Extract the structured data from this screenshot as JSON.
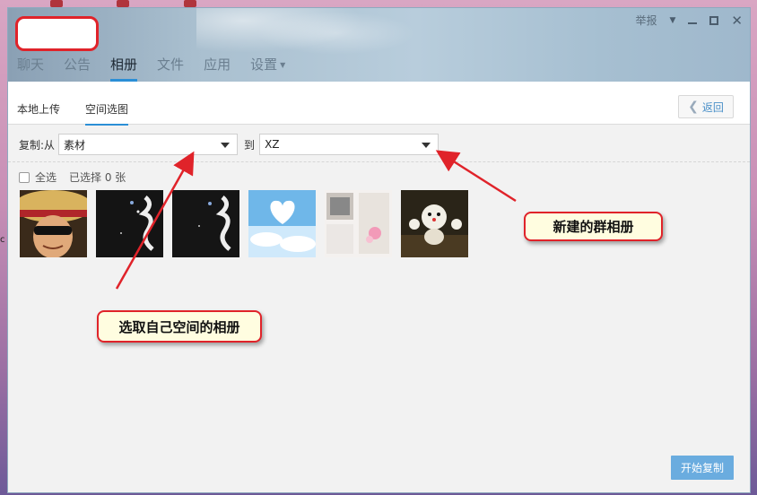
{
  "window": {
    "report_label": "举报",
    "nav_tabs": [
      {
        "label": "聊天"
      },
      {
        "label": "公告"
      },
      {
        "label": "相册"
      },
      {
        "label": "文件"
      },
      {
        "label": "应用"
      },
      {
        "label": "设置"
      }
    ],
    "active_nav": "相册"
  },
  "subtabs": {
    "local_upload": "本地上传",
    "space_pick": "空间选图",
    "back_label": "返回"
  },
  "copy": {
    "from_label": "复制:从",
    "from_value": "素材",
    "to_label": "到",
    "to_value": "XZ"
  },
  "selection": {
    "select_all": "全选",
    "selected_text": "已选择 0 张"
  },
  "photos": [
    {
      "name": "straw-hat-avatar"
    },
    {
      "name": "dark-calligraphy-1"
    },
    {
      "name": "dark-calligraphy-2"
    },
    {
      "name": "cloud-heart-love"
    },
    {
      "name": "collage-flowers"
    },
    {
      "name": "doraemon-figures"
    }
  ],
  "start_copy_label": "开始复制",
  "callouts": {
    "new_album": "新建的群相册",
    "pick_own": "选取自己空间的相册"
  },
  "colors": {
    "accent": "#2b8fd6",
    "callout_border": "#e0232a",
    "callout_fill": "#fffde0",
    "start_button": "#6aacdf"
  }
}
